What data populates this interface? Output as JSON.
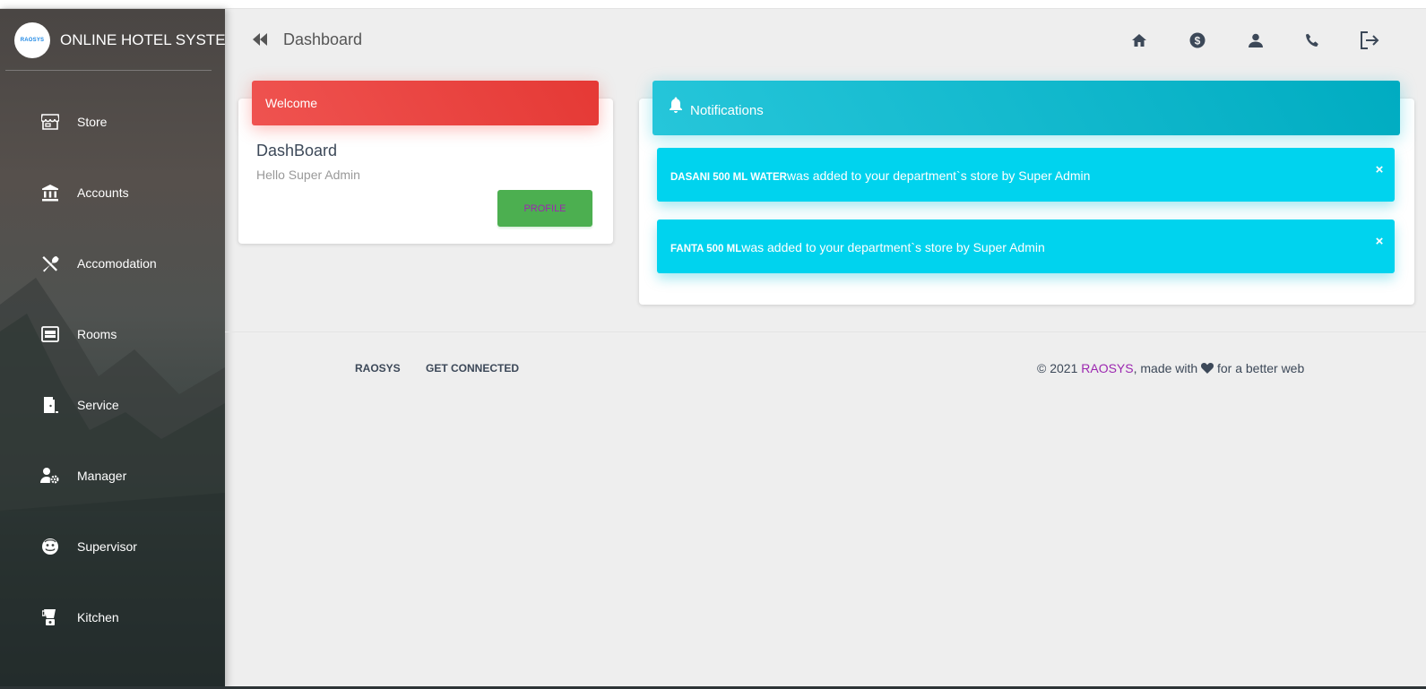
{
  "brand": {
    "logo_text": "RAOSYS",
    "title": "ONLINE HOTEL SYSTEM"
  },
  "sidebar": {
    "items": [
      {
        "label": "Store",
        "icon": "store-icon"
      },
      {
        "label": "Accounts",
        "icon": "bank-icon"
      },
      {
        "label": "Accomodation",
        "icon": "utensils-icon"
      },
      {
        "label": "Rooms",
        "icon": "bed-icon"
      },
      {
        "label": "Service",
        "icon": "door-icon"
      },
      {
        "label": "Manager",
        "icon": "user-cog-icon"
      },
      {
        "label": "Supervisor",
        "icon": "face-icon"
      },
      {
        "label": "Kitchen",
        "icon": "blender-icon"
      }
    ]
  },
  "topbar": {
    "title": "Dashboard",
    "icons": [
      "home-icon",
      "dollar-icon",
      "user-icon",
      "phone-icon",
      "logout-icon"
    ]
  },
  "welcome": {
    "header": "Welcome",
    "title": "DashBoard",
    "subtitle": "Hello Super Admin",
    "button": "PROFILE"
  },
  "notifications": {
    "header": "Notifications",
    "items": [
      {
        "item": "DASANI 500 ML WATER",
        "message": "was added to your department`s store by Super Admin",
        "close": "×"
      },
      {
        "item": "FANTA 500 ML",
        "message": "was added to your department`s store by Super Admin",
        "close": "×"
      }
    ]
  },
  "footer": {
    "links": [
      "RAOSYS",
      "GET CONNECTED"
    ],
    "copyright_prefix": "© 2021 ",
    "copyright_brand": "RAOSYS",
    "copyright_mid": ", made with ",
    "copyright_suffix": " for a better web"
  },
  "colors": {
    "welcome_red": "#e53935",
    "notif_cyan": "#00acc1",
    "alert_cyan": "#00d3ee",
    "profile_green": "#4caf50",
    "link_purple": "#9c27b0"
  }
}
